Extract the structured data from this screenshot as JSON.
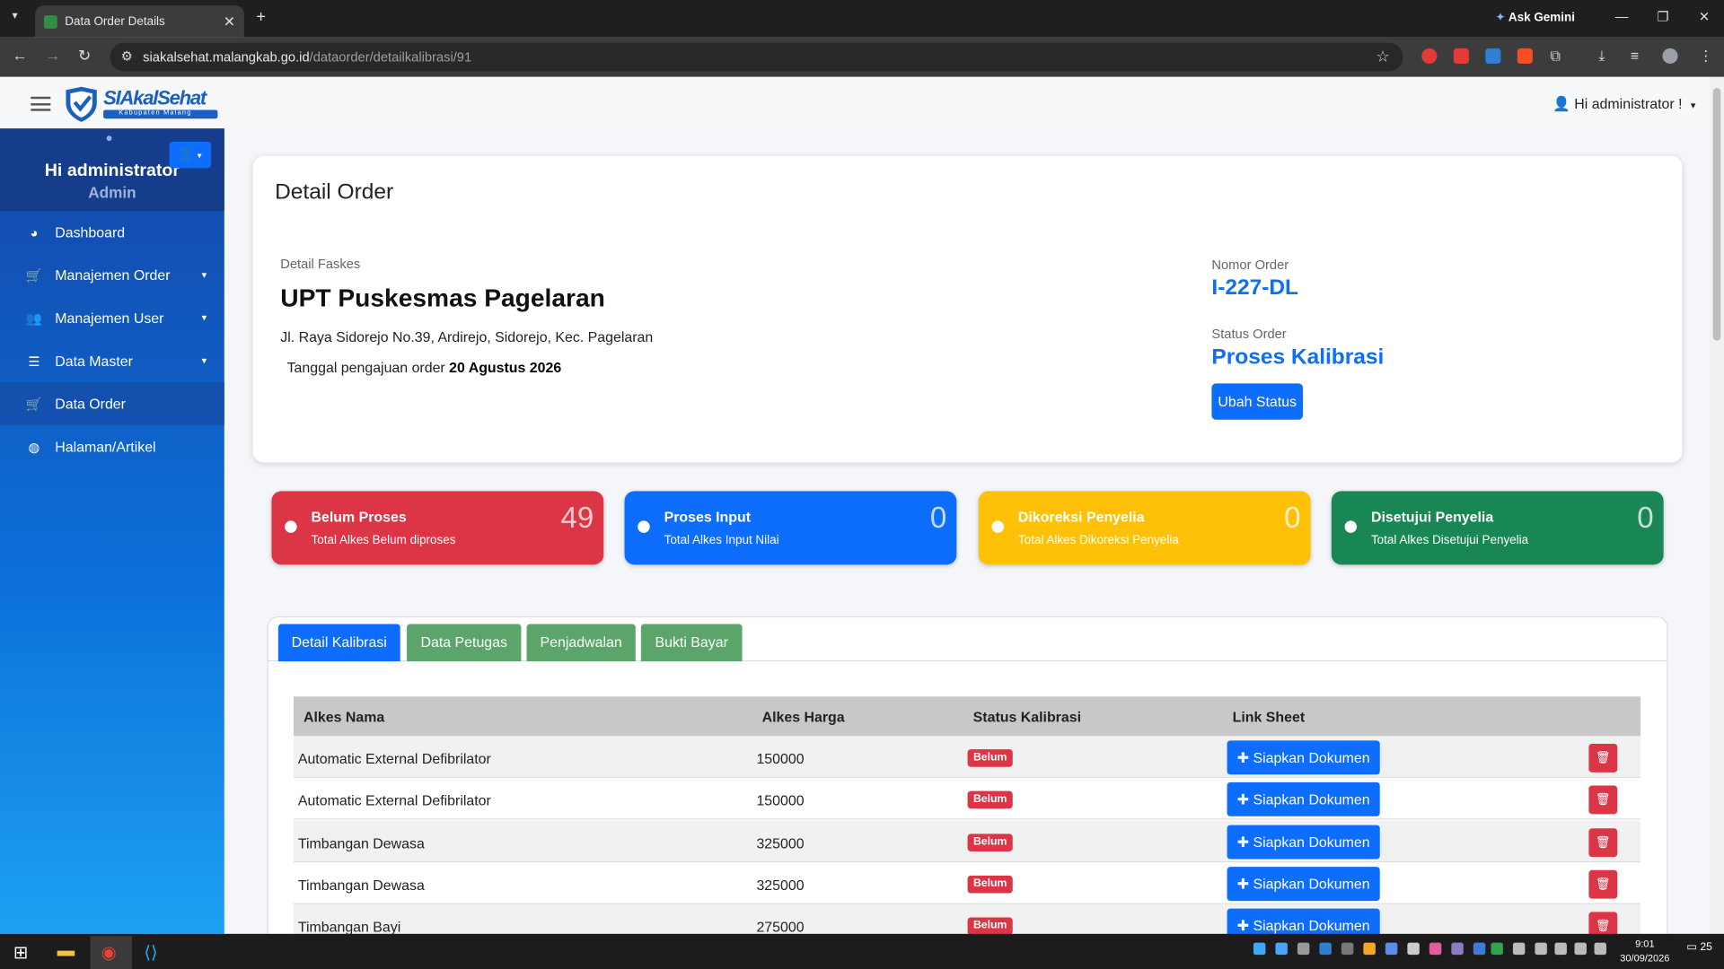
{
  "browser": {
    "tab_title": "Data Order Details",
    "tab_close": "✕",
    "new_tab": "+",
    "ask_gemini": "Ask Gemini",
    "url_host": "siakalsehat.malangkab.go.id",
    "url_path": "/dataorder/detailkalibrasi/91"
  },
  "topbar": {
    "logo_text": "SIAkalSehat",
    "logo_sub": "Kabupaten Malang",
    "user_greeting": "Hi administrator !"
  },
  "sidebar": {
    "user_name": "Hi administrator",
    "user_role": "Admin",
    "items": [
      {
        "label": "Dashboard",
        "icon": "pie-chart-icon",
        "caret": ""
      },
      {
        "label": "Manajemen Order",
        "icon": "cart-icon",
        "caret": "▾"
      },
      {
        "label": "Manajemen User",
        "icon": "users-icon",
        "caret": "▾"
      },
      {
        "label": "Data Master",
        "icon": "list-icon",
        "caret": "▾"
      },
      {
        "label": "Data Order",
        "icon": "cart-icon",
        "caret": ""
      },
      {
        "label": "Halaman/Artikel",
        "icon": "globe-icon",
        "caret": ""
      }
    ]
  },
  "detail": {
    "title": "Detail Order",
    "faskes_label": "Detail Faskes",
    "faskes_name": "UPT Puskesmas Pagelaran",
    "address": "Jl. Raya Sidorejo No.39, Ardirejo, Sidorejo, Kec. Pagelaran",
    "tanggal_label": "Tanggal pengajuan order",
    "tanggal_value": "20 Agustus 2026",
    "nomor_label": "Nomor Order",
    "nomor_value": "I-227-DL",
    "status_label": "Status Order",
    "status_value": "Proses Kalibrasi",
    "ubah_button": "Ubah Status"
  },
  "stats": [
    {
      "title": "Belum Proses",
      "subtitle": "Total Alkes Belum diproses",
      "count": "49",
      "color": "#dc3545"
    },
    {
      "title": "Proses Input",
      "subtitle": "Total Alkes Input Nilai",
      "count": "0",
      "color": "#0d6efd"
    },
    {
      "title": "Dikoreksi Penyelia",
      "subtitle": "Total Alkes Dikoreksi Penyelia",
      "count": "0",
      "color": "#ffc107"
    },
    {
      "title": "Disetujui Penyelia",
      "subtitle": "Total Alkes Disetujui Penyelia",
      "count": "0",
      "color": "#198754"
    }
  ],
  "tabs": [
    "Detail Kalibrasi",
    "Data Petugas",
    "Penjadwalan",
    "Bukti Bayar"
  ],
  "table": {
    "headers": [
      "Alkes Nama",
      "Alkes Harga",
      "Status Kalibrasi",
      "Link Sheet"
    ],
    "rows": [
      {
        "nama": "Automatic External Defibrilator",
        "harga": "150000",
        "status": "Belum",
        "action": "Siapkan Dokumen"
      },
      {
        "nama": "Automatic External Defibrilator",
        "harga": "150000",
        "status": "Belum",
        "action": "Siapkan Dokumen"
      },
      {
        "nama": "Timbangan Dewasa",
        "harga": "325000",
        "status": "Belum",
        "action": "Siapkan Dokumen"
      },
      {
        "nama": "Timbangan Dewasa",
        "harga": "325000",
        "status": "Belum",
        "action": "Siapkan Dokumen"
      },
      {
        "nama": "Timbangan Bayi",
        "harga": "275000",
        "status": "Belum",
        "action": "Siapkan Dokumen"
      }
    ]
  },
  "taskbar": {
    "time": "9:01",
    "date": "30/09/2026",
    "notif_count": "25"
  }
}
